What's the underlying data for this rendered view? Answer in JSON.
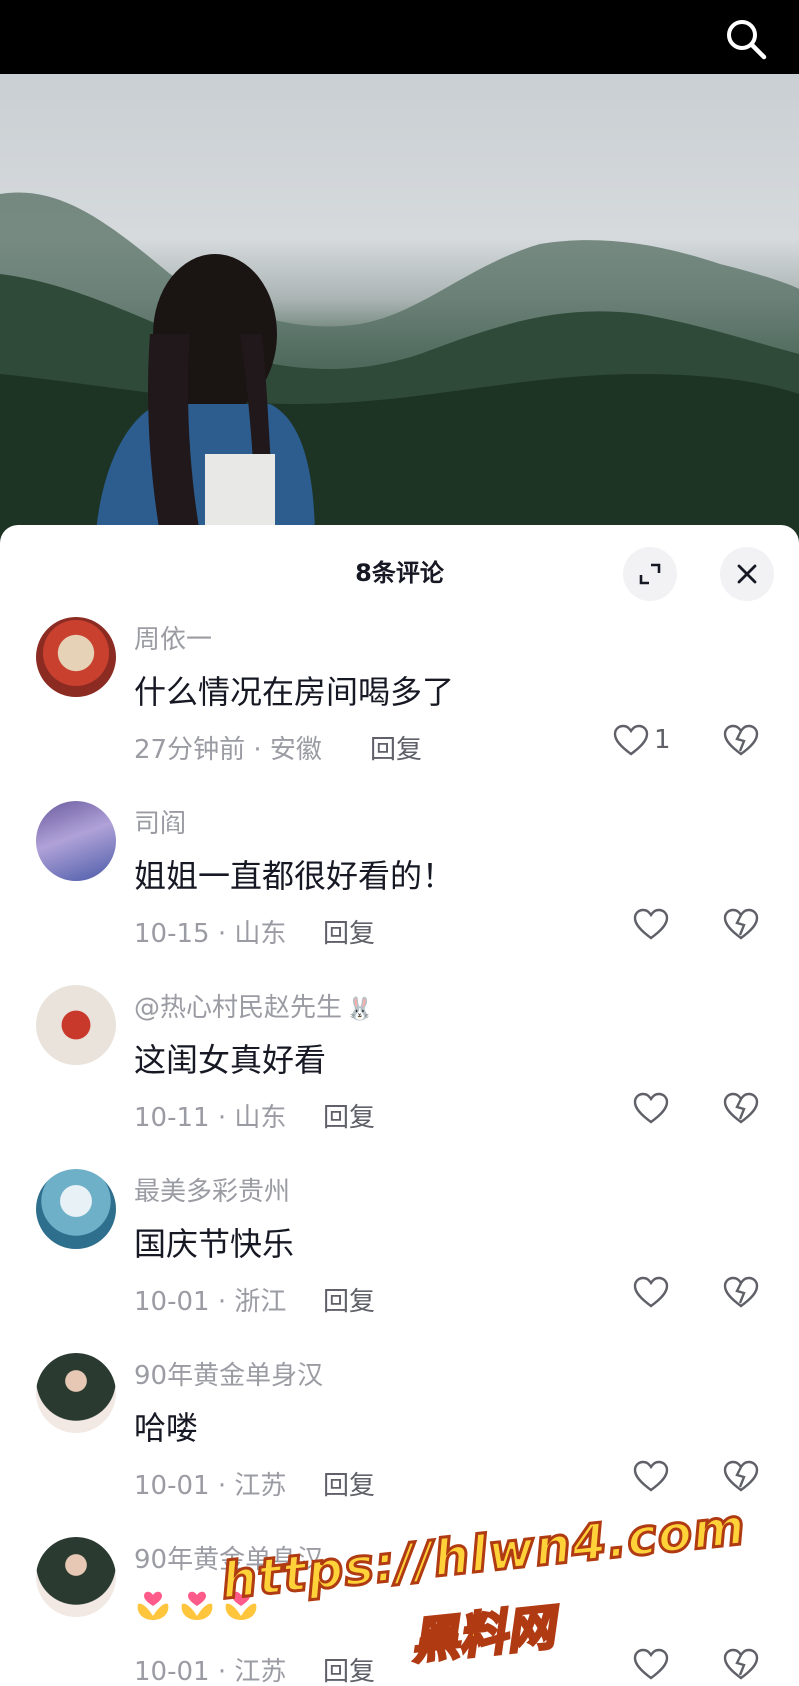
{
  "header": {
    "search_icon": "search-icon"
  },
  "sheet": {
    "title": "8条评论",
    "expand_icon": "expand-icon",
    "close_icon": "close-icon"
  },
  "comments": [
    {
      "user": "周依一",
      "text": "什么情况在房间喝多了",
      "time": "27分钟前 · 安徽",
      "reply": "回复",
      "likes": "1"
    },
    {
      "user": "司阎",
      "text": "姐姐一直都很好看的！",
      "time": "10-15 · 山东",
      "reply": "回复",
      "likes": ""
    },
    {
      "user": "@热心村民赵先生",
      "text": "这闺女真好看",
      "time": "10-11 · 山东",
      "reply": "回复",
      "likes": ""
    },
    {
      "user": "最美多彩贵州",
      "text": "国庆节快乐",
      "time": "10-01 · 浙江",
      "reply": "回复",
      "likes": ""
    },
    {
      "user": "90年黄金单身汉",
      "text": "哈喽",
      "time": "10-01 · 江苏",
      "reply": "回复",
      "likes": ""
    },
    {
      "user": "90年黄金单身汉",
      "text": "",
      "time": "10-01 · 江苏",
      "reply": "回复",
      "likes": ""
    }
  ],
  "watermark": {
    "url": "https://hlwn4.com",
    "name": "黑料网"
  },
  "colors": {
    "accent": "#161823",
    "muted": "#9b9ca3",
    "watermark": "#ffd23a"
  }
}
